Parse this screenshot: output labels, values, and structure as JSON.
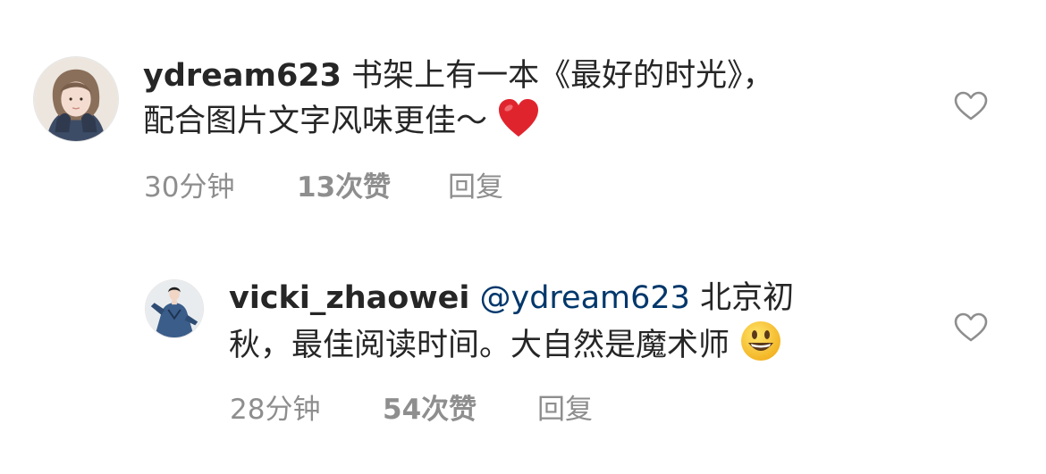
{
  "comments": [
    {
      "username": "ydream623",
      "text_line1": "书架上有一本《最好的时光》，",
      "text_line2": "配合图片文字风味更佳～",
      "emoji": "red-heart",
      "time": "30分钟",
      "likes": "13次赞",
      "reply": "回复"
    },
    {
      "username": "vicki_zhaowei",
      "mention": "@ydream623",
      "text_line1": "北京初",
      "text_line2": "秋，最佳阅读时间。大自然是魔术师",
      "emoji": "grinning-face",
      "time": "28分钟",
      "likes": "54次赞",
      "reply": "回复"
    }
  ],
  "colors": {
    "text": "#262626",
    "secondary": "#8e8e8e",
    "mention": "#00376b",
    "heart_emoji": "#e0242e"
  }
}
